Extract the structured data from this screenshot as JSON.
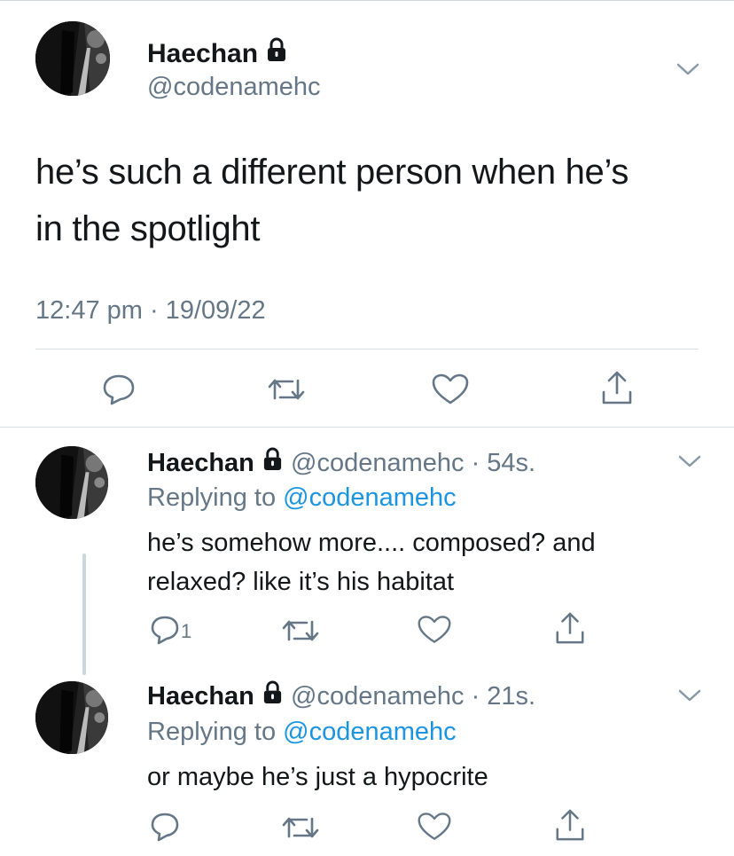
{
  "main_tweet": {
    "author_name": "Haechan",
    "handle": "@codenamehc",
    "text_line1": "he’s such a different person when he’s",
    "text_line2": "in the spotlight",
    "timestamp": "12:47 pm · 19/09/22"
  },
  "replies": [
    {
      "author_name": "Haechan",
      "handle_time": "@codenamehc · 54s.",
      "replying_prefix": "Replying to",
      "replying_handle": "@codenamehc",
      "text_line1": "he’s somehow more.... composed? and",
      "text_line2": "relaxed? like it’s his habitat",
      "reply_count": "1"
    },
    {
      "author_name": "Haechan",
      "handle_time": "@codenamehc · 21s.",
      "replying_prefix": "Replying to",
      "replying_handle": "@codenamehc",
      "text_line1": "or maybe he’s just a hypocrite",
      "reply_count": ""
    }
  ],
  "icons": {
    "reply": "reply-icon",
    "retweet": "retweet-icon",
    "like": "heart-icon",
    "share": "share-icon",
    "more": "chevron-down-icon",
    "protected": "lock-icon"
  },
  "colors": {
    "text": "#14171a",
    "muted": "#657786",
    "link": "#1b95e0",
    "divider": "#d9dee2"
  }
}
